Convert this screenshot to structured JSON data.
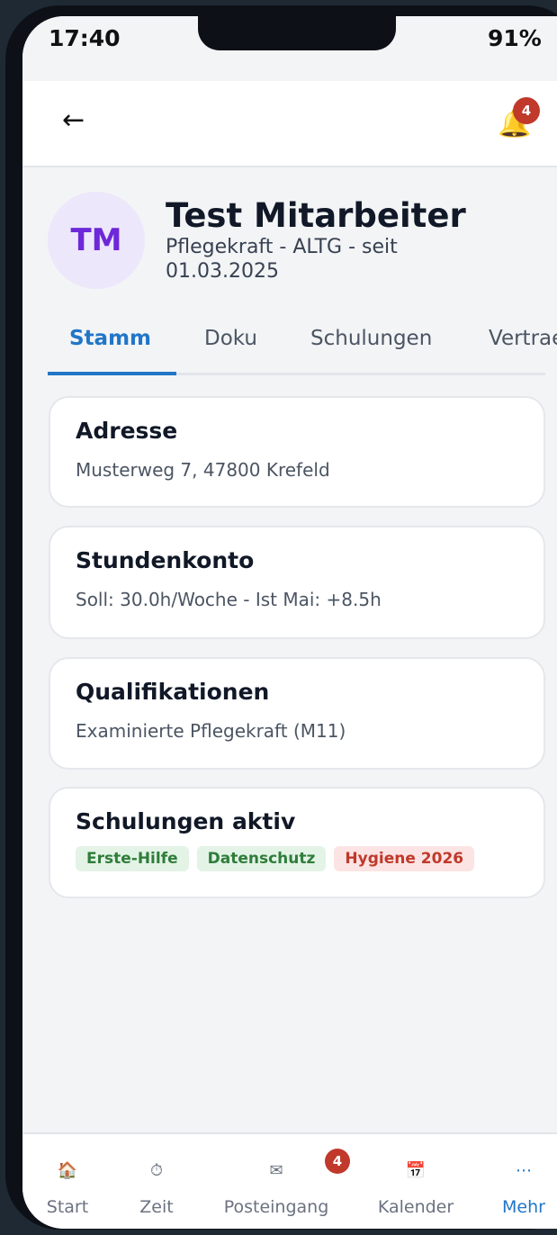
{
  "status": {
    "time": "17:40",
    "battery": "91%"
  },
  "header": {
    "back_icon": "arrow-left-icon",
    "bell_icon": "bell-icon",
    "notification_count": "4"
  },
  "profile": {
    "initials": "TM",
    "name": "Test Mitarbeiter",
    "subtitle": "Pflegekraft - ALTG - seit 01.03.2025"
  },
  "tabs": [
    {
      "label": "Stamm",
      "active": true
    },
    {
      "label": "Doku"
    },
    {
      "label": "Schulungen"
    },
    {
      "label": "Vertraege"
    }
  ],
  "cards": {
    "address": {
      "title": "Adresse",
      "text": "Musterweg 7, 47800 Krefeld"
    },
    "hours": {
      "title": "Stundenkonto",
      "text": "Soll: 30.0h/Woche - Ist Mai: +8.5h"
    },
    "qualifications": {
      "title": "Qualifikationen",
      "text": "Examinierte Pflegekraft (M11)"
    },
    "trainings": {
      "title": "Schulungen aktiv",
      "chips": [
        "Erste-Hilfe",
        "Datenschutz",
        "Hygiene 2026"
      ]
    }
  },
  "nav": [
    {
      "label": "Start",
      "icon": "house-icon"
    },
    {
      "label": "Zeit",
      "icon": "stopwatch-icon"
    },
    {
      "label": "Posteingang",
      "icon": "envelope-icon",
      "badge": "4"
    },
    {
      "label": "Kalender",
      "icon": "calendar-icon"
    },
    {
      "label": "Mehr",
      "icon": "more-icon",
      "active": true
    }
  ],
  "colors": {
    "accent": "#2176c7",
    "badge": "#c0392b",
    "avatar_bg": "#ece7fb",
    "avatar_text": "#6d28d9"
  }
}
